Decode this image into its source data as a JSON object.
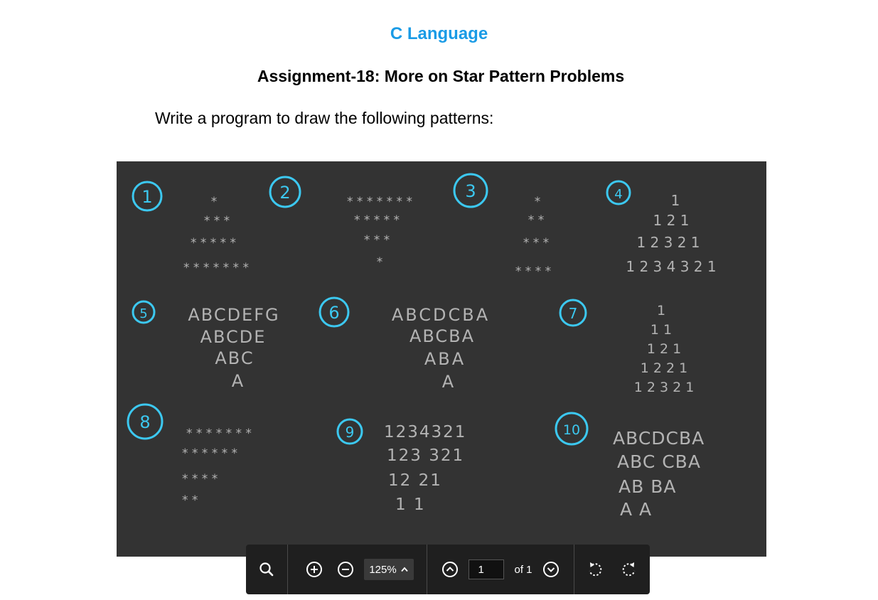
{
  "document": {
    "title": "C Language",
    "subtitle": "Assignment-18: More on Star Pattern Problems",
    "intro": "Write a program to draw the following patterns:"
  },
  "colors": {
    "title": "#1a9be6",
    "board_background": "#333333",
    "badge": "#3cc8f0",
    "chalk": "#b3b3b3",
    "toolbar_background": "#1f1f1f"
  },
  "board": {
    "badges": [
      "1",
      "2",
      "3",
      "4",
      "5",
      "6",
      "7",
      "8",
      "9",
      "10"
    ],
    "patterns": [
      {
        "id": "1",
        "rows": [
          "*",
          "* * *",
          "* * * * *",
          "* * * * * * *"
        ]
      },
      {
        "id": "2",
        "rows": [
          "* * * * * * *",
          "* * * * *",
          "* * *",
          "*"
        ]
      },
      {
        "id": "3",
        "rows": [
          "*",
          "*   *",
          "*   *   *",
          "*   *   *   *"
        ]
      },
      {
        "id": "4",
        "rows": [
          "1",
          "1 2 1",
          "1 2 3 2 1",
          "1 2 3 4 3 2 1"
        ]
      },
      {
        "id": "5",
        "rows": [
          "ABCDEFG",
          "ABCDE",
          "ABC",
          "A"
        ]
      },
      {
        "id": "6",
        "rows": [
          "ABCDCBA",
          "ABCBA",
          "ABA",
          "A"
        ]
      },
      {
        "id": "7",
        "rows": [
          "1",
          "1   1",
          "1   2   1",
          "1   2   2   1",
          "1   2   3   2   1"
        ]
      },
      {
        "id": "8",
        "rows": [
          "* * * *  * * *",
          "* * *      * * *",
          "* *            * *",
          "*                    *"
        ]
      },
      {
        "id": "9",
        "rows": [
          "1234321",
          "123  321",
          "12      21",
          "1          1"
        ]
      },
      {
        "id": "10",
        "rows": [
          "ABCDCBA",
          "ABC  CBA",
          "AB      BA",
          "A          A"
        ]
      }
    ]
  },
  "toolbar": {
    "search_icon": "search-icon",
    "zoom_in_icon": "zoom-in-icon",
    "zoom_out_icon": "zoom-out-icon",
    "zoom_level": "125%",
    "prev_icon": "chevron-up-circle-icon",
    "page_number": "1",
    "page_total": "of 1",
    "next_icon": "chevron-down-circle-icon",
    "rotate_ccw_icon": "rotate-ccw-icon",
    "rotate_cw_icon": "rotate-cw-icon"
  }
}
